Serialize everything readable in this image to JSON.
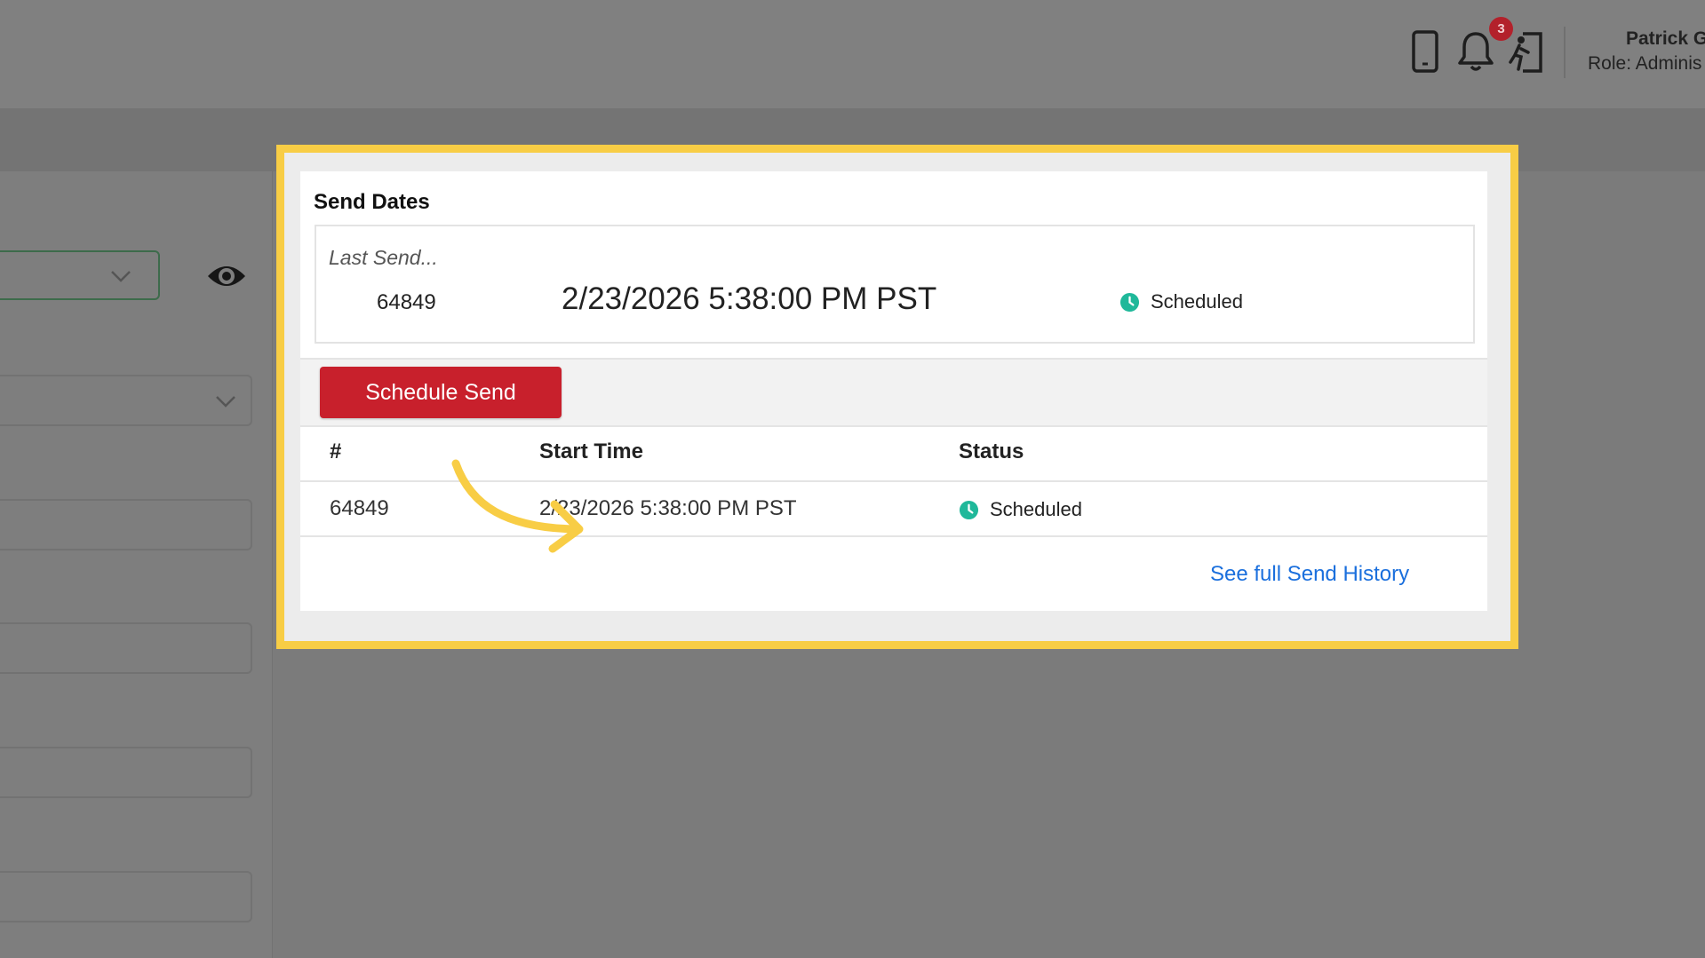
{
  "header": {
    "notification_count": "3",
    "user_name": "Patrick G",
    "user_role": "Role: Adminis",
    "icons": [
      "mobile-device-icon",
      "bell-icon",
      "logout-icon"
    ]
  },
  "send_dates": {
    "title": "Send Dates",
    "last_send": {
      "label": "Last Send...",
      "id": "64849",
      "time": "2/23/2026 5:38:00 PM PST",
      "status": "Scheduled"
    },
    "schedule_button": "Schedule Send",
    "table": {
      "columns": [
        "#",
        "Start Time",
        "Status"
      ],
      "rows": [
        {
          "id": "64849",
          "start_time": "2/23/2026 5:38:00 PM PST",
          "status": "Scheduled"
        }
      ]
    },
    "history_link": "See full Send History"
  },
  "colors": {
    "highlight": "#f8cd45",
    "primary_button": "#c8202c",
    "status_scheduled": "#1fb89a",
    "link": "#1a6fdd"
  }
}
